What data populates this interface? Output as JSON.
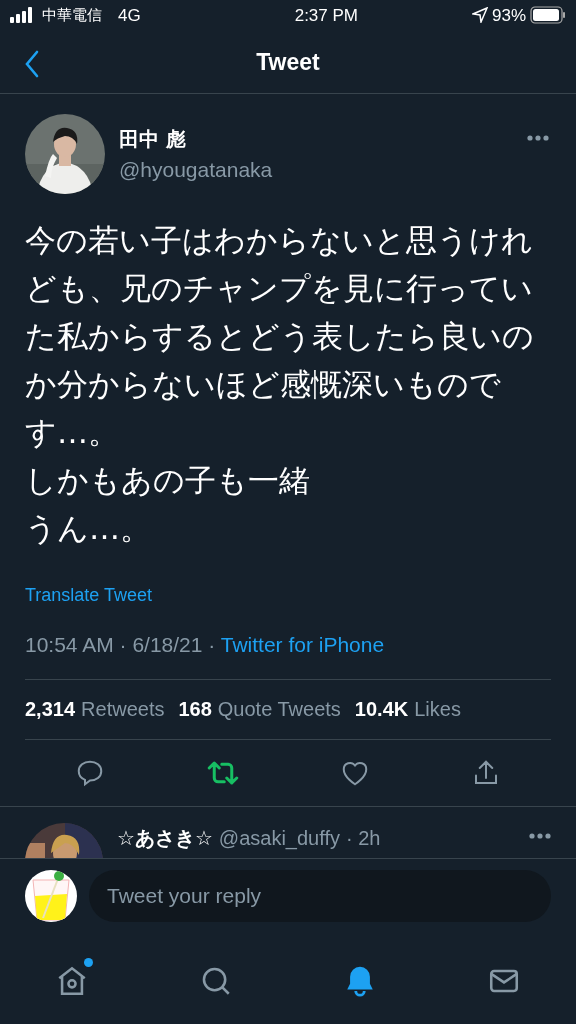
{
  "status_bar": {
    "carrier": "中華電信",
    "network": "4G",
    "time": "2:37 PM",
    "battery": "93%"
  },
  "header": {
    "title": "Tweet"
  },
  "tweet": {
    "author": {
      "name": "田中 彪",
      "handle": "@hyougatanaka"
    },
    "paragraphs": [
      "今の若い子はわからないと思うけれども、兄のチャンプを見に行っていた私からするとどう表したら良いのか分からないほど感慨深いものです…。",
      "しかもあの子も一緒",
      "うん…。"
    ],
    "translate": "Translate Tweet",
    "timestamp": "10:54 AM · 6/18/21 · ",
    "source": "Twitter for iPhone",
    "stats": [
      {
        "count": "2,314",
        "label": "Retweets"
      },
      {
        "count": "168",
        "label": "Quote Tweets"
      },
      {
        "count": "10.4K",
        "label": "Likes"
      }
    ],
    "actions": [
      {
        "kind": "reply",
        "active": false
      },
      {
        "kind": "retweet",
        "active": true
      },
      {
        "kind": "like",
        "active": false
      },
      {
        "kind": "share",
        "active": false
      }
    ]
  },
  "reply_preview": {
    "name": "☆あさき☆",
    "handle": "@asaki_duffy",
    "time": "· 2h"
  },
  "composer": {
    "placeholder": "Tweet your reply"
  },
  "tab_bar": [
    {
      "kind": "home",
      "selected": false,
      "badge": true
    },
    {
      "kind": "search",
      "selected": false,
      "badge": false
    },
    {
      "kind": "notifications",
      "selected": true,
      "badge": false
    },
    {
      "kind": "messages",
      "selected": false,
      "badge": false
    }
  ]
}
